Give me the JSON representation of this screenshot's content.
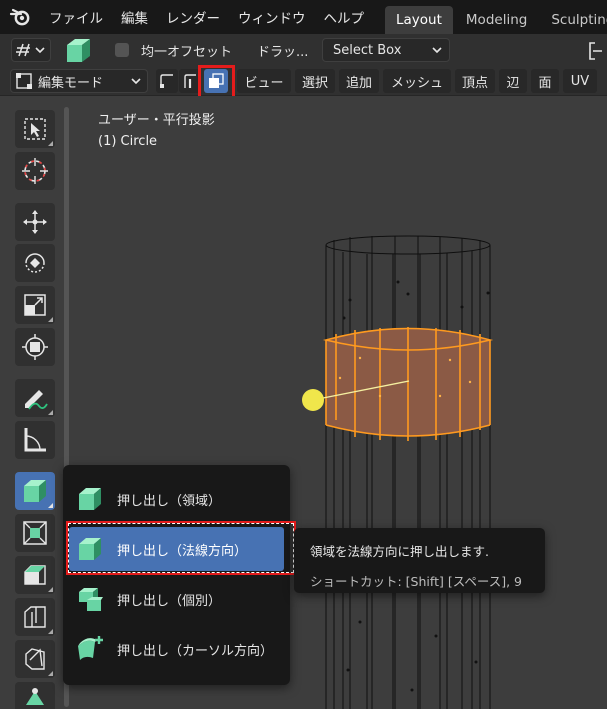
{
  "topbar": {
    "menus": [
      "ファイル",
      "編集",
      "レンダー",
      "ウィンドウ",
      "ヘルプ"
    ],
    "workspaces": [
      "Layout",
      "Modeling",
      "Sculpting"
    ],
    "active_workspace": "Layout"
  },
  "header": {
    "even_offset_label": "均一オフセット",
    "drag_label": "ドラッ...",
    "select_box_label": "Select Box",
    "mode_label": "編集モード",
    "menus": [
      "ビュー",
      "選択",
      "追加",
      "メッシュ",
      "頂点",
      "辺",
      "面",
      "UV"
    ]
  },
  "viewport": {
    "view_label": "ユーザー・平行投影",
    "object_label": "(1) Circle"
  },
  "flyout": {
    "items": [
      {
        "label": "押し出し（領域）"
      },
      {
        "label": "押し出し（法線方向）"
      },
      {
        "label": "押し出し（個別）"
      },
      {
        "label": "押し出し（カーソル方向）"
      }
    ]
  },
  "tooltip": {
    "description": "領域を法線方向に押し出します.",
    "shortcut": "ショートカット: [Shift] [スペース], 9"
  },
  "colors": {
    "accent": "#4772b3",
    "highlight_red": "#e41c1c",
    "selection_orange": "#ff9a1f",
    "gizmo_yellow": "#f0e64b"
  }
}
